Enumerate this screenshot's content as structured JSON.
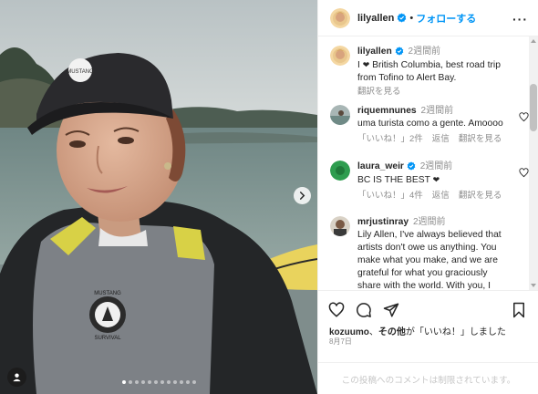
{
  "post": {
    "username": "lilyallen",
    "follow_label": "フォローする",
    "separator": "•",
    "more_label": "···",
    "caption": {
      "username": "lilyallen",
      "time": "2週間前",
      "text_before": "I ",
      "text_after": " British Columbia, best road trip from Tofino to Alert Bay.",
      "translate_label": "翻訳を見る"
    },
    "comments": [
      {
        "username": "riquemnunes",
        "time": "2週間前",
        "text": "uma turista como a gente. Amoooo",
        "likes": "「いいね！」2件",
        "reply": "返信",
        "translate": "翻訳を見る"
      },
      {
        "username": "laura_weir",
        "time": "2週間前",
        "text": "BC IS THE BEST ",
        "likes": "「いいね！」4件",
        "reply": "返信",
        "translate": "翻訳を見る"
      },
      {
        "username": "mrjustinray",
        "time": "2週間前",
        "text": "Lily Allen, I've always believed that artists don't owe us anything. You make what you make, and we are grateful for what you graciously share with the world. With you, I"
      }
    ],
    "liked_by": {
      "user": "kozuumo",
      "separator": "、",
      "rest_bold": "その他",
      "rest_text": "が「いいね！」しました"
    },
    "date": "8月7日",
    "comments_restricted": "この投稿へのコメントは制限されています。"
  },
  "photo": {
    "cap_logo_text": "MUSTANG",
    "vest_logo_lines": [
      "MUSTANG",
      "SURVIVAL"
    ],
    "carousel_count": 12,
    "carousel_active": 0
  },
  "icons": {
    "verified": "verified-badge-icon",
    "heart": "heart-icon",
    "comment": "comment-icon",
    "share": "share-icon",
    "save": "bookmark-icon",
    "next": "chevron-right-icon",
    "user_tag": "person-icon"
  },
  "colors": {
    "link_blue": "#0095f6",
    "verified_blue": "#0095f6",
    "muted": "#8e8e8e",
    "text": "#262626",
    "border": "#efefef"
  }
}
